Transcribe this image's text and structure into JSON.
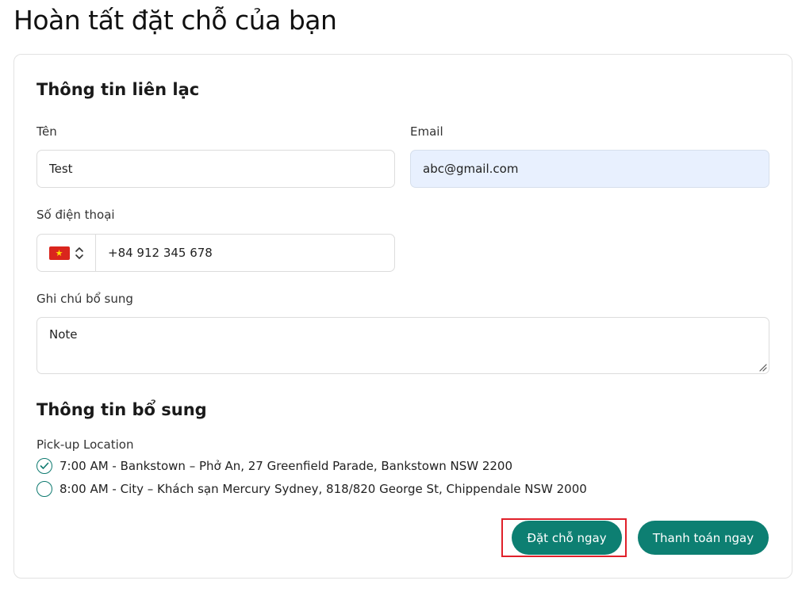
{
  "page": {
    "title": "Hoàn tất đặt chỗ của bạn"
  },
  "contact": {
    "section_title": "Thông tin liên lạc",
    "name_label": "Tên",
    "name_value": "Test",
    "email_label": "Email",
    "email_value": "abc@gmail.com",
    "phone_label": "Số điện thoại",
    "phone_value": "+84 912 345 678",
    "phone_country_icon": "vietnam-flag-icon",
    "note_label": "Ghi chú bổ sung",
    "note_value": "Note"
  },
  "additional": {
    "section_title": "Thông tin bổ sung",
    "pickup_label": "Pick-up Location",
    "options": [
      {
        "label": "7:00 AM - Bankstown – Phở An, 27 Greenfield Parade, Bankstown NSW 2200",
        "selected": true
      },
      {
        "label": "8:00 AM - City – Khách sạn Mercury Sydney, 818/820 George St, Chippendale NSW 2000",
        "selected": false
      }
    ]
  },
  "actions": {
    "book_now_label": "Đặt chỗ ngay",
    "pay_now_label": "Thanh toán ngay"
  },
  "colors": {
    "accent": "#0d7f72",
    "autofill_bg": "#e8f0fe",
    "highlight": "#e0202a"
  }
}
